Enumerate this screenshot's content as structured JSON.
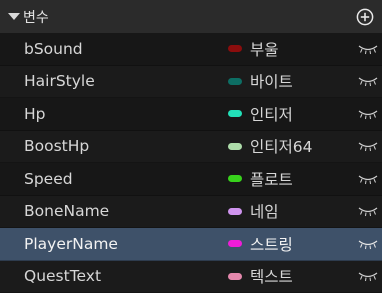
{
  "header": {
    "title": "변수"
  },
  "rows": [
    {
      "name": "bSound",
      "type": "부울",
      "color": "#8b0d0d"
    },
    {
      "name": "HairStyle",
      "type": "바이트",
      "color": "#0d6e64"
    },
    {
      "name": "Hp",
      "type": "인티저",
      "color": "#22e0b8"
    },
    {
      "name": "BoostHp",
      "type": "인티저64",
      "color": "#aedcaa"
    },
    {
      "name": "Speed",
      "type": "플로트",
      "color": "#38d21c"
    },
    {
      "name": "BoneName",
      "type": "네임",
      "color": "#cf94ee"
    },
    {
      "name": "PlayerName",
      "type": "스트링",
      "color": "#f01cd8"
    },
    {
      "name": "QuestText",
      "type": "텍스트",
      "color": "#e488ac"
    }
  ],
  "selected_row": "PlayerName"
}
